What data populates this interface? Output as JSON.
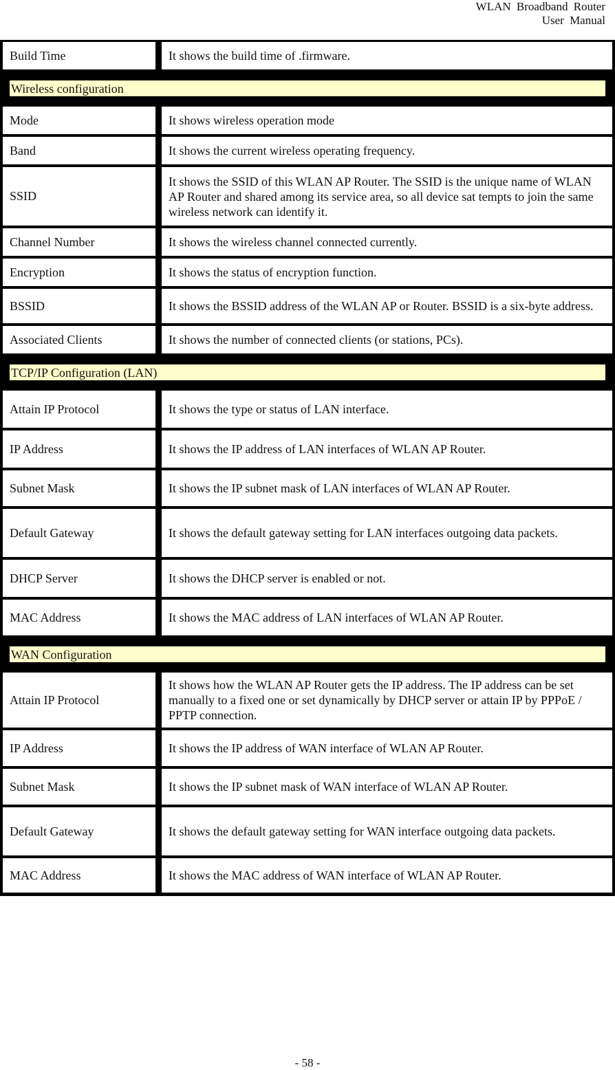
{
  "header": {
    "line1": "WLAN  Broadband  Router",
    "line2": "User  Manual"
  },
  "table": {
    "rows": [
      {
        "type": "row",
        "label": "Build Time",
        "desc": "It shows the build time of .firmware.",
        "h": 40
      },
      {
        "type": "section",
        "title": "Wireless configuration"
      },
      {
        "type": "row",
        "label": "Mode",
        "desc": "It shows wireless operation mode",
        "h": 40
      },
      {
        "type": "row",
        "label": "Band",
        "desc": "It shows the current wireless operating frequency.",
        "h": 40
      },
      {
        "type": "row",
        "label": "SSID",
        "desc": "It shows the SSID of this WLAN AP Router. The SSID is the unique name of WLAN AP Router and shared among its service area, so all device sat tempts to join the same wireless network can identify it.",
        "h": 85
      },
      {
        "type": "row",
        "label": "Channel Number",
        "desc": "It shows the wireless channel connected currently.",
        "h": 40
      },
      {
        "type": "row",
        "label": "Encryption",
        "desc": "It shows the status of encryption function.",
        "h": 40
      },
      {
        "type": "row",
        "label": "BSSID",
        "desc": "It shows the BSSID address of the WLAN AP or Router. BSSID is a six-byte address.",
        "h": 50
      },
      {
        "type": "row",
        "label": "Associated Clients",
        "desc": "It shows the number of connected clients (or stations, PCs).",
        "h": 40
      },
      {
        "type": "section",
        "title": "TCP/IP Configuration (LAN)"
      },
      {
        "type": "row",
        "label": "Attain IP Protocol",
        "desc": "It shows the type or status of LAN interface.",
        "h": 54
      },
      {
        "type": "row",
        "label": "IP Address",
        "desc": "It shows the IP address of LAN interfaces of WLAN AP Router.",
        "h": 54
      },
      {
        "type": "row",
        "label": "Subnet Mask",
        "desc": "It shows the IP subnet mask of LAN interfaces of WLAN AP Router.",
        "h": 52
      },
      {
        "type": "row",
        "label": "Default Gateway",
        "desc": "It shows the default gateway setting for LAN interfaces outgoing data packets.",
        "h": 70
      },
      {
        "type": "row",
        "label": "DHCP Server",
        "desc": "It shows the DHCP server is enabled or not.",
        "h": 54
      },
      {
        "type": "row",
        "label": "MAC Address",
        "desc": "It shows the MAC address of LAN interfaces of WLAN AP Router.",
        "h": 52
      },
      {
        "type": "section",
        "title": "WAN Configuration"
      },
      {
        "type": "row",
        "label": "Attain IP Protocol",
        "desc": "It shows how the WLAN AP Router gets the IP address. The IP address can be set manually to a fixed one or set dynamically by DHCP server or attain IP by PPPoE / PPTP connection.",
        "h": 80
      },
      {
        "type": "row",
        "label": "IP Address",
        "desc": "It shows the IP address of WAN interface of WLAN AP Router.",
        "h": 52
      },
      {
        "type": "row",
        "label": "Subnet Mask",
        "desc": "It shows the IP subnet mask of WAN interface of WLAN AP Router.",
        "h": 52
      },
      {
        "type": "row",
        "label": "Default Gateway",
        "desc": "It shows the default gateway setting for WAN interface outgoing data packets.",
        "h": 70
      },
      {
        "type": "row",
        "label": "MAC Address",
        "desc": "It shows the MAC address of WAN interface of WLAN AP Router.",
        "h": 50
      }
    ]
  },
  "footer": {
    "page": "- 58 -"
  }
}
